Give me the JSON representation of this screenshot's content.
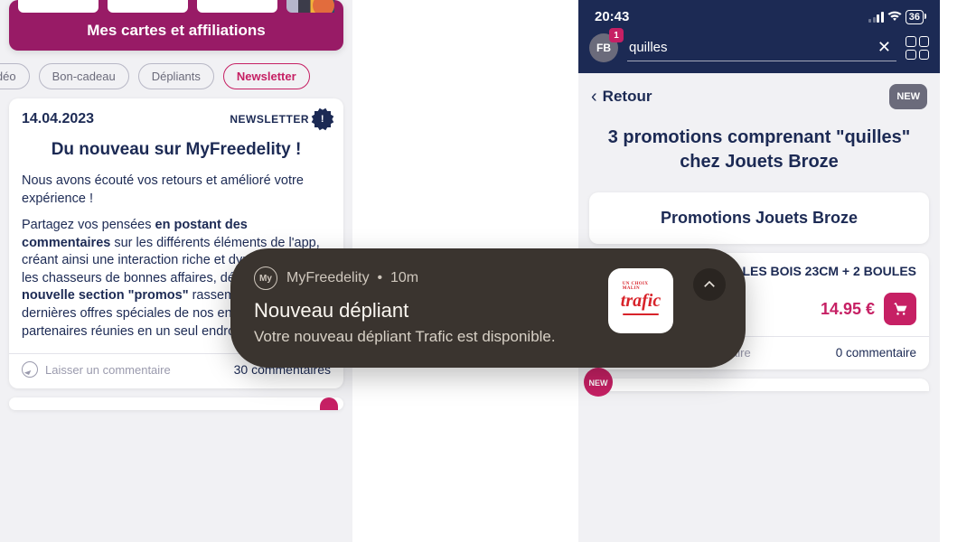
{
  "left": {
    "banner_title": "Mes cartes et affiliations",
    "chips": [
      "idéo",
      "Bon-cadeau",
      "Dépliants",
      "Newsletter"
    ],
    "news": {
      "date": "14.04.2023",
      "tag": "NEWSLETTER",
      "title": "Du nouveau sur MyFreedelity !",
      "p1": "Nous avons écouté vos retours et amélioré votre expérience !",
      "p2a": "Partagez vos pensées ",
      "p2b": "en postant des commentaires",
      "p2c": " sur les différents éléments de l'app, créant ainsi une interaction riche et dynamique. Pour les chasseurs de bonnes affaires, découvrez ",
      "p2d": "la nouvelle section \"promos\"",
      "p2e": " rassemblant toutes les dernières offres spéciales de nos enseignes partenaires réunies en un seul endroit.",
      "leave_comment": "Laisser un commentaire",
      "comments": "30 commentaires"
    }
  },
  "right": {
    "time": "20:43",
    "battery": "36",
    "avatar": "FB",
    "avatar_badge": "1",
    "search_value": "quilles",
    "back": "Retour",
    "new_badge": "NEW",
    "title": "3 promotions comprenant \"quilles\" chez Jouets Broze",
    "brand": "Promotions Jouets Broze",
    "item": {
      "name": "QUILLES BOIS 23CM + 2 BOULES",
      "price": "14.95 €",
      "leave_comment": "Laisser un commentaire",
      "comments": "0 commentaire"
    },
    "round_new": "NEW"
  },
  "notif": {
    "app": "MyFreedelity",
    "age": "10m",
    "logo_text": "trafic",
    "logo_sub": "UN CHOIX MALIN",
    "title": "Nouveau dépliant",
    "body": "Votre nouveau dépliant Trafic est disponible."
  }
}
